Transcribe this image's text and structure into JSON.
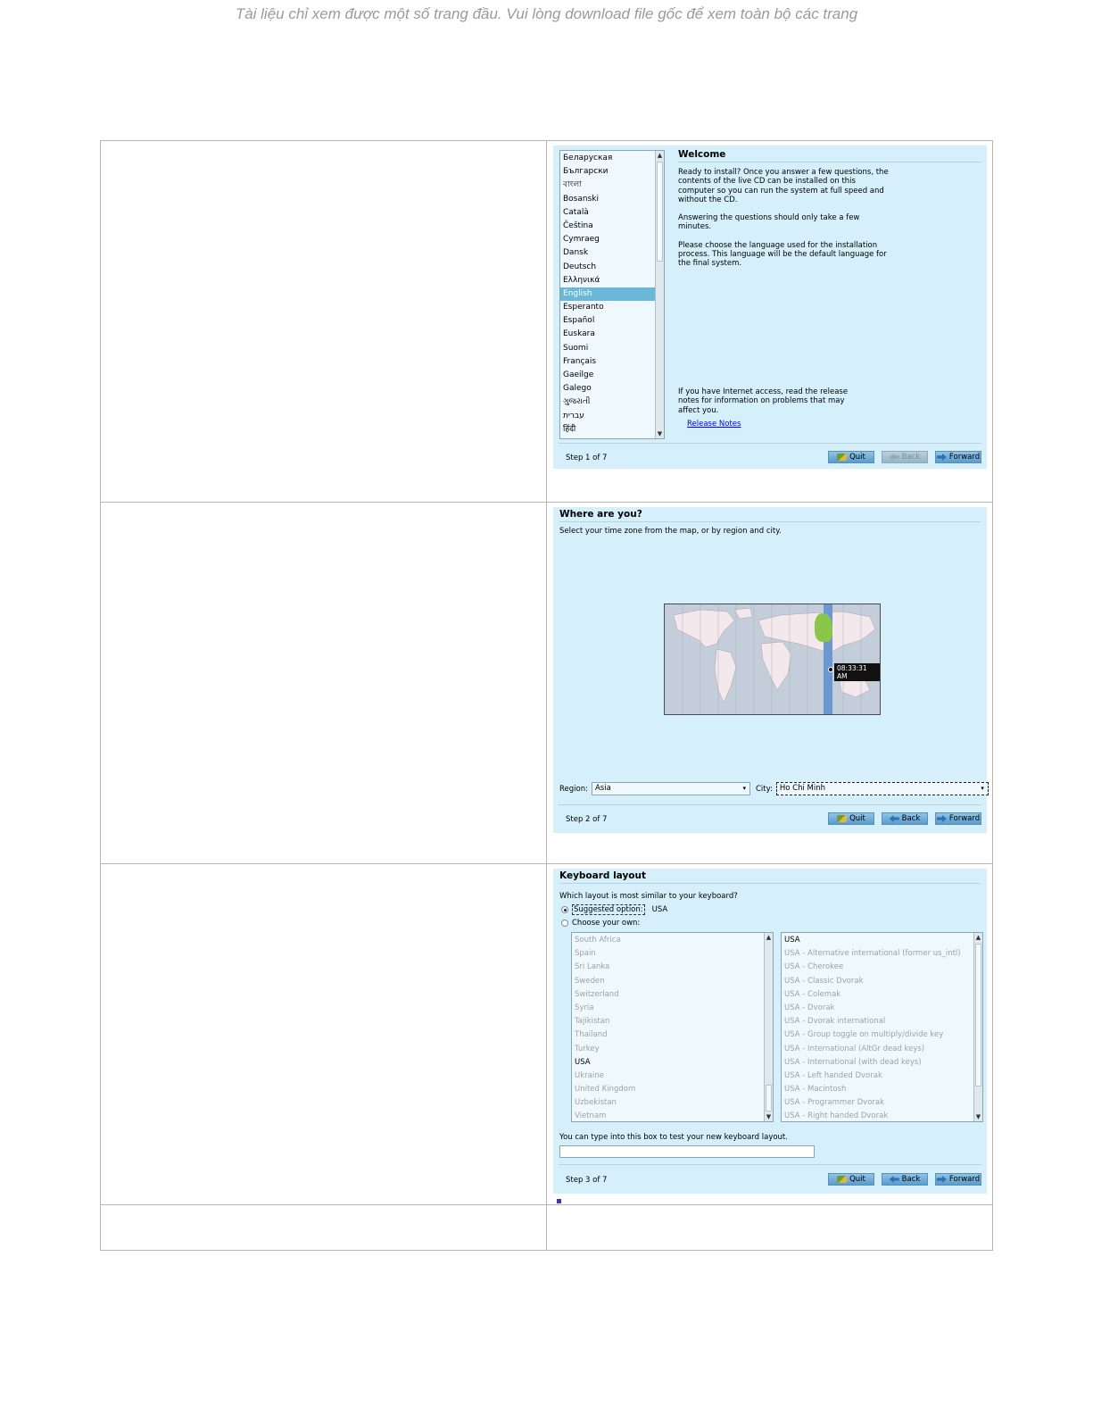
{
  "notice": "Tài liệu chỉ xem được một số trang đầu. Vui lòng download file gốc để xem toàn bộ các trang",
  "colors": {
    "panel_bg": "#d5f0fb",
    "selection": "#6ab7d8",
    "button": "#5a9ccc",
    "map_highlight": "#8ac64a"
  },
  "step1": {
    "languages": [
      "Беларуская",
      "Български",
      "বাংলা",
      "Bosanski",
      "Català",
      "Čeština",
      "Cymraeg",
      "Dansk",
      "Deutsch",
      "Ελληνικά",
      "English",
      "Esperanto",
      "Español",
      "Euskara",
      "Suomi",
      "Français",
      "Gaeilge",
      "Galego",
      "ગુજરાતી",
      "עברית",
      "हिंदी"
    ],
    "selected_language": "English",
    "title": "Welcome",
    "para1": "Ready to install? Once you answer a few questions, the contents of the live CD can be installed on this computer so you can run the system at full speed and without the CD.",
    "para2": "Answering the questions should only take a few minutes.",
    "para3": "Please choose the language used for the installation process. This language will be the default language for the final system.",
    "release_text": "If you have Internet access, read the release notes for information on problems that may affect you.",
    "release_link": "Release Notes",
    "step": "Step 1 of 7"
  },
  "step2": {
    "title": "Where are you?",
    "subtitle": "Select your time zone from the map, or by region and city.",
    "time": "08:33:31 AM",
    "region_label": "Region:",
    "region_value": "Asia",
    "city_label": "City:",
    "city_value": "Ho Chi Minh",
    "step": "Step 2 of 7"
  },
  "step3": {
    "title": "Keyboard layout",
    "question": "Which layout is most similar to your keyboard?",
    "suggested_label": "Suggested option:",
    "suggested_value": "USA",
    "choose_label": "Choose your own:",
    "countries": [
      "South Africa",
      "Spain",
      "Sri Lanka",
      "Sweden",
      "Switzerland",
      "Syria",
      "Tajikistan",
      "Thailand",
      "Turkey",
      "USA",
      "Ukraine",
      "United Kingdom",
      "Uzbekistan",
      "Vietnam"
    ],
    "active_country": "USA",
    "variants": [
      "USA",
      "USA - Alternative international (former us_intl)",
      "USA - Cherokee",
      "USA - Classic Dvorak",
      "USA - Colemak",
      "USA - Dvorak",
      "USA - Dvorak international",
      "USA - Group toggle on multiply/divide key",
      "USA - International (AltGr dead keys)",
      "USA - International (with dead keys)",
      "USA - Left handed Dvorak",
      "USA - Macintosh",
      "USA - Programmer Dvorak",
      "USA - Right handed Dvorak"
    ],
    "active_variant": "USA",
    "test_label": "You can type into this box to test your new keyboard layout.",
    "step": "Step 3 of 7"
  },
  "buttons": {
    "quit": "Quit",
    "back": "Back",
    "forward": "Forward"
  }
}
